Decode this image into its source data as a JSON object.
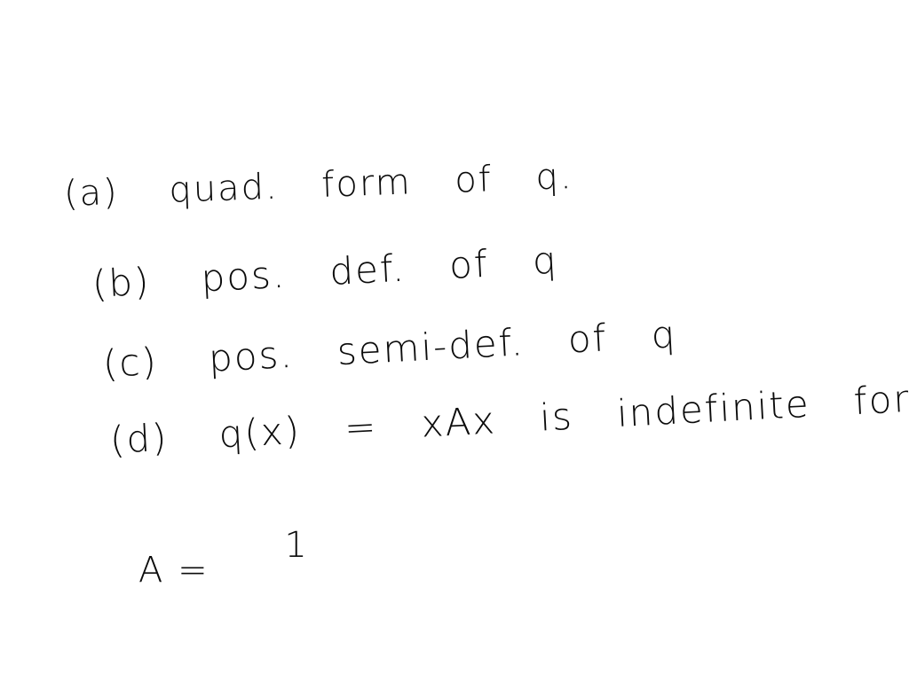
{
  "notes": {
    "items": [
      {
        "label": "(a)",
        "segments": [
          "quad.",
          "form",
          "of",
          "q."
        ]
      },
      {
        "label": "(b)",
        "segments": [
          "pos.",
          "def.",
          "of",
          "q"
        ]
      },
      {
        "label": "(c)",
        "segments": [
          "pos.",
          "semi-def.",
          "of",
          "q"
        ]
      },
      {
        "label": "(d)",
        "segments": [
          "q(x)",
          "=",
          "xAx",
          "is",
          "indefinite",
          "for"
        ]
      }
    ],
    "matrix": {
      "lhs": "A =",
      "first_entry": "1"
    }
  }
}
